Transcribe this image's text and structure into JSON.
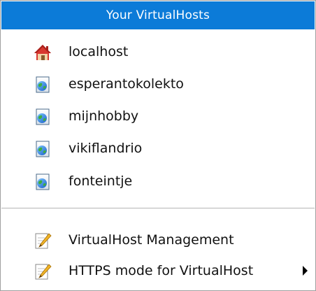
{
  "menu": {
    "title": "Your VirtualHosts",
    "hosts": [
      {
        "label": "localhost",
        "icon": "home-icon"
      },
      {
        "label": "esperantokolekto",
        "icon": "web-page-icon"
      },
      {
        "label": "mijnhobby",
        "icon": "web-page-icon"
      },
      {
        "label": "vikiflandrio",
        "icon": "web-page-icon"
      },
      {
        "label": "fonteintje",
        "icon": "web-page-icon"
      }
    ],
    "actions": [
      {
        "label": "VirtualHost Management",
        "icon": "edit-document-icon"
      },
      {
        "label": "HTTPS mode for VirtualHost",
        "icon": "edit-document-icon",
        "submenu_icon": "submenu-arrow-icon"
      }
    ]
  },
  "colors": {
    "header_background": "#0c7bd8",
    "header_text": "#ffffff",
    "menu_background": "#ffffff"
  }
}
